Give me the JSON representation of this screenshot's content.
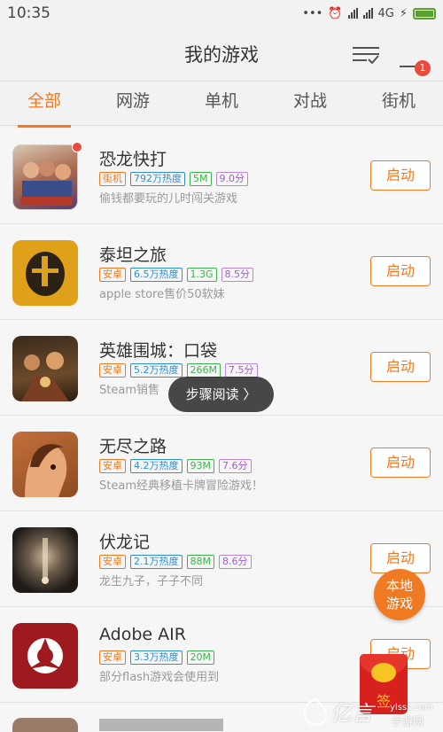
{
  "status": {
    "time": "10:35",
    "network": "4G",
    "dots": "•••"
  },
  "header": {
    "title": "我的游戏",
    "notification_count": "1"
  },
  "tabs": [
    "全部",
    "网游",
    "单机",
    "对战",
    "街机"
  ],
  "games": [
    {
      "name": "恐龙快打",
      "platform": "街机",
      "heat": "792万热度",
      "size": "5M",
      "score": "9.0分",
      "desc": "偷钱都要玩的儿时闯关游戏",
      "button": "启动"
    },
    {
      "name": "泰坦之旅",
      "platform": "安卓",
      "heat": "6.5万热度",
      "size": "1.3G",
      "score": "8.5分",
      "desc": "apple store售价50软妹",
      "button": "启动"
    },
    {
      "name": "英雄围城：口袋",
      "platform": "安卓",
      "heat": "5.2万热度",
      "size": "266M",
      "score": "7.5分",
      "desc": "Steam销售",
      "button": "启动"
    },
    {
      "name": "无尽之路",
      "platform": "安卓",
      "heat": "4.2万热度",
      "size": "93M",
      "score": "7.6分",
      "desc": "Steam经典移植卡牌冒险游戏！",
      "button": "启动"
    },
    {
      "name": "伏龙记",
      "platform": "安卓",
      "heat": "2.1万热度",
      "size": "88M",
      "score": "8.6分",
      "desc": "龙生九子，子子不同",
      "button": "启动"
    },
    {
      "name": "Adobe AIR",
      "platform": "安卓",
      "heat": "3.3万热度",
      "size": "20M",
      "score": "",
      "desc": "部分flash游戏会使用到",
      "button": "启动"
    }
  ],
  "toast": "步骤阅读 〉",
  "local_games": {
    "line1": "本地",
    "line2": "游戏"
  },
  "redenvelope": {
    "seal": "签"
  },
  "watermark": {
    "main": "亿言",
    "sub": "ylsss.com",
    "sub2": "手游网"
  }
}
